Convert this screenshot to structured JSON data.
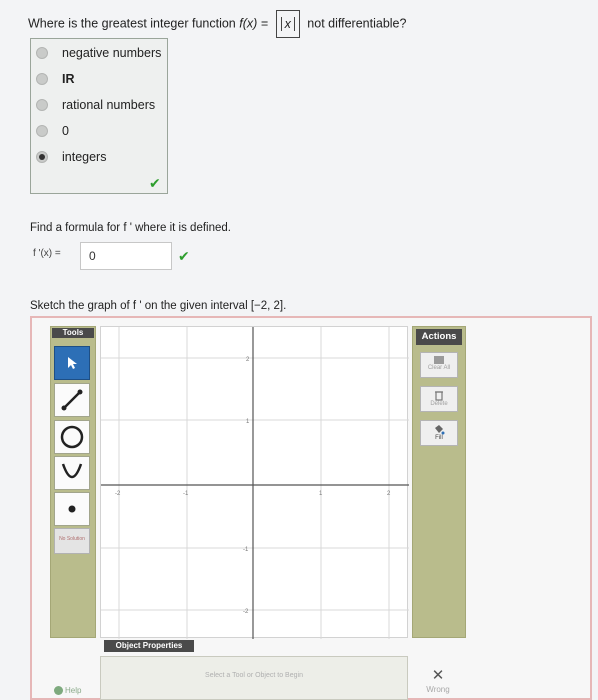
{
  "question1": {
    "prefix": "Where is the greatest integer function",
    "func": "f(x) =",
    "bracket_var": "x",
    "suffix": "not differentiable?",
    "options": [
      {
        "label": "negative numbers",
        "selected": false
      },
      {
        "label": "IR",
        "selected": false
      },
      {
        "label": "rational numbers",
        "selected": false
      },
      {
        "label": "0",
        "selected": false
      },
      {
        "label": "integers",
        "selected": true
      }
    ],
    "status": "correct"
  },
  "question2": {
    "prompt": "Find a formula for f ' where it is defined.",
    "field_label": "f '(x) =",
    "answer": "0",
    "status": "correct"
  },
  "question3": {
    "prompt": "Sketch the graph of f ' on the given interval [−2, 2].",
    "tools_label": "Tools",
    "tools": [
      "select-pointer",
      "line-segment",
      "circle",
      "parabola",
      "point"
    ],
    "no_solution": "No Solution",
    "actions_label": "Actions",
    "actions": [
      "Clear All",
      "Delete",
      "Fill"
    ],
    "object_properties_label": "Object Properties",
    "hint": "Select a Tool or Object to Begin",
    "result": "Wrong",
    "help": "Help"
  },
  "graph": {
    "x_ticks": [
      "-2",
      "-1",
      "1",
      "2"
    ],
    "y_ticks": [
      "2",
      "1",
      "-1",
      "-2"
    ]
  }
}
